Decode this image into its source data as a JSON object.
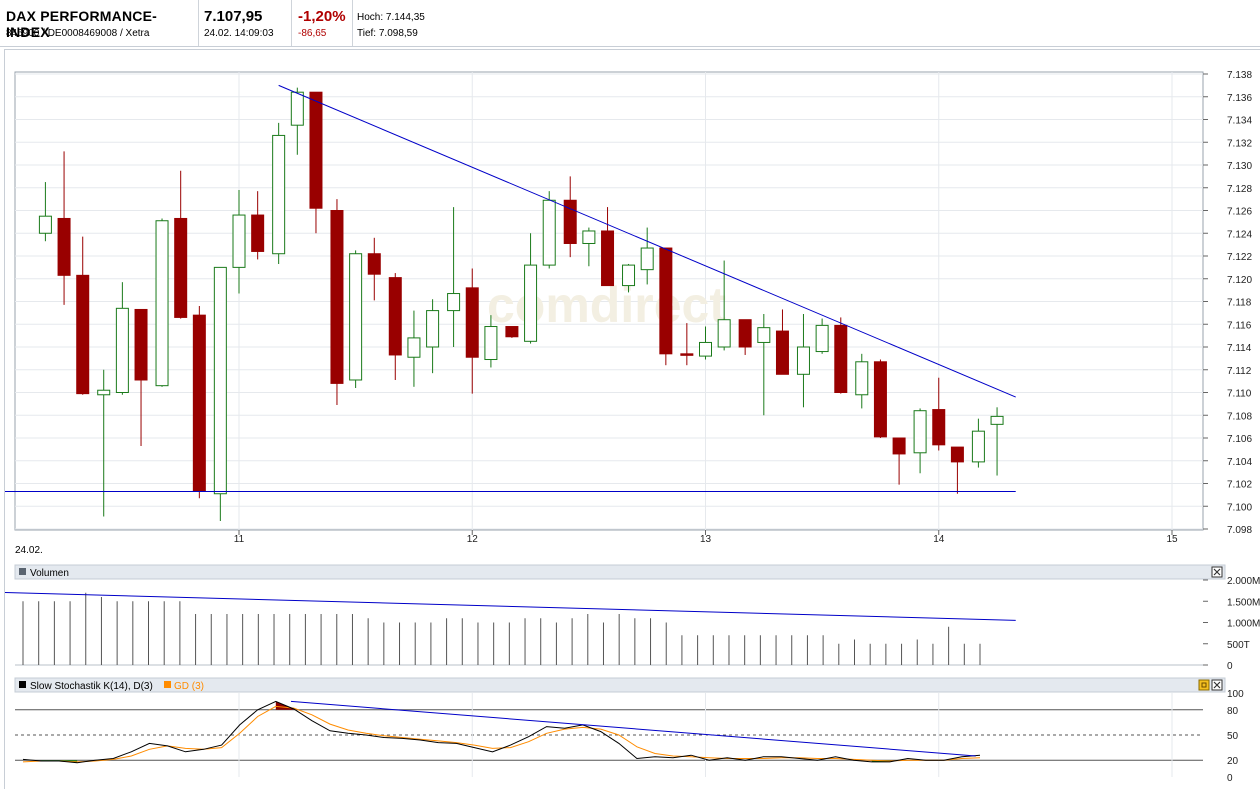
{
  "header": {
    "name": "DAX PERFORMANCE-INDEX",
    "ids": "846900 / DE0008469008 / Xetra",
    "price": "7.107,95",
    "datetime": "24.02. 14:09:03",
    "change_pct": "-1,20%",
    "change_abs": "-86,65",
    "high": "Hoch: 7.144,35",
    "low": "Tief: 7.098,59"
  },
  "watermark": "comdirect",
  "main_chart": {
    "date_label": "24.02.",
    "y_ticks": [
      "7.138",
      "7.136",
      "7.134",
      "7.132",
      "7.130",
      "7.128",
      "7.126",
      "7.124",
      "7.122",
      "7.120",
      "7.118",
      "7.116",
      "7.114",
      "7.112",
      "7.110",
      "7.108",
      "7.106",
      "7.104",
      "7.102",
      "7.100",
      "7.098"
    ],
    "x_ticks": [
      "11",
      "12",
      "13",
      "14",
      "15"
    ]
  },
  "volume_panel": {
    "title": "Volumen",
    "y_ticks": [
      "2.000M",
      "1.500M",
      "1.000M",
      "500T",
      "0"
    ]
  },
  "stoch_panel": {
    "title": "Slow Stochastik K(14), D(3)",
    "gd_label": "GD (3)",
    "y_ticks": [
      "100",
      "80",
      "50",
      "20",
      "0"
    ]
  },
  "colors": {
    "up": "#ffffff",
    "up_border": "#1a7a1a",
    "down": "#990000",
    "trendline": "#0000c8",
    "k_line": "#000000",
    "d_line": "#ff8c00",
    "overbought_fill": "#8b0000",
    "oversold_fill": "#1a8a1a"
  },
  "chart_data": {
    "type": "candlestick",
    "x_label": "24.02.",
    "x_ticks": [
      11,
      12,
      13,
      14,
      15
    ],
    "ylim": [
      7098,
      7138.5
    ],
    "candles": [
      {
        "t": 10.17,
        "o": 7124.0,
        "h": 7128.5,
        "l": 7123.3,
        "c": 7125.5
      },
      {
        "t": 10.25,
        "o": 7125.3,
        "h": 7131.2,
        "l": 7117.7,
        "c": 7120.3
      },
      {
        "t": 10.33,
        "o": 7120.3,
        "h": 7123.7,
        "l": 7109.8,
        "c": 7109.9
      },
      {
        "t": 10.42,
        "o": 7109.8,
        "h": 7112.0,
        "l": 7099.1,
        "c": 7110.2
      },
      {
        "t": 10.5,
        "o": 7110.0,
        "h": 7119.7,
        "l": 7109.8,
        "c": 7117.4
      },
      {
        "t": 10.58,
        "o": 7117.3,
        "h": 7117.3,
        "l": 7105.3,
        "c": 7111.1
      },
      {
        "t": 10.67,
        "o": 7110.6,
        "h": 7125.3,
        "l": 7110.5,
        "c": 7125.1
      },
      {
        "t": 10.75,
        "o": 7125.3,
        "h": 7129.5,
        "l": 7116.5,
        "c": 7116.6
      },
      {
        "t": 10.83,
        "o": 7116.8,
        "h": 7117.6,
        "l": 7100.7,
        "c": 7101.3
      },
      {
        "t": 10.92,
        "o": 7101.1,
        "h": 7121.0,
        "l": 7098.7,
        "c": 7121.0
      },
      {
        "t": 11.0,
        "o": 7121.0,
        "h": 7127.8,
        "l": 7118.7,
        "c": 7125.6
      },
      {
        "t": 11.08,
        "o": 7125.6,
        "h": 7127.7,
        "l": 7121.7,
        "c": 7122.4
      },
      {
        "t": 11.17,
        "o": 7122.2,
        "h": 7133.7,
        "l": 7121.3,
        "c": 7132.6
      },
      {
        "t": 11.25,
        "o": 7133.5,
        "h": 7136.8,
        "l": 7130.9,
        "c": 7136.4
      },
      {
        "t": 11.33,
        "o": 7136.4,
        "h": 7136.4,
        "l": 7124.0,
        "c": 7126.2
      },
      {
        "t": 11.42,
        "o": 7126.0,
        "h": 7127.0,
        "l": 7108.9,
        "c": 7110.8
      },
      {
        "t": 11.5,
        "o": 7111.1,
        "h": 7122.5,
        "l": 7110.4,
        "c": 7122.2
      },
      {
        "t": 11.58,
        "o": 7122.2,
        "h": 7123.6,
        "l": 7118.1,
        "c": 7120.4
      },
      {
        "t": 11.67,
        "o": 7120.1,
        "h": 7120.5,
        "l": 7111.1,
        "c": 7113.3
      },
      {
        "t": 11.75,
        "o": 7113.1,
        "h": 7117.2,
        "l": 7110.5,
        "c": 7114.8
      },
      {
        "t": 11.83,
        "o": 7114.0,
        "h": 7118.2,
        "l": 7111.7,
        "c": 7117.2
      },
      {
        "t": 11.92,
        "o": 7117.2,
        "h": 7126.3,
        "l": 7114.0,
        "c": 7118.7
      },
      {
        "t": 12.0,
        "o": 7119.2,
        "h": 7120.9,
        "l": 7109.9,
        "c": 7113.1
      },
      {
        "t": 12.08,
        "o": 7112.9,
        "h": 7116.8,
        "l": 7112.2,
        "c": 7115.8
      },
      {
        "t": 12.17,
        "o": 7115.8,
        "h": 7115.8,
        "l": 7114.8,
        "c": 7114.9
      },
      {
        "t": 12.25,
        "o": 7114.5,
        "h": 7124.0,
        "l": 7114.3,
        "c": 7121.2
      },
      {
        "t": 12.33,
        "o": 7121.2,
        "h": 7127.7,
        "l": 7120.9,
        "c": 7126.9
      },
      {
        "t": 12.42,
        "o": 7126.9,
        "h": 7129.0,
        "l": 7121.9,
        "c": 7123.1
      },
      {
        "t": 12.5,
        "o": 7123.1,
        "h": 7124.5,
        "l": 7121.1,
        "c": 7124.2
      },
      {
        "t": 12.58,
        "o": 7124.2,
        "h": 7126.3,
        "l": 7119.5,
        "c": 7119.4
      },
      {
        "t": 12.67,
        "o": 7119.4,
        "h": 7121.3,
        "l": 7118.8,
        "c": 7121.2
      },
      {
        "t": 12.75,
        "o": 7120.8,
        "h": 7124.5,
        "l": 7119.5,
        "c": 7122.7
      },
      {
        "t": 12.83,
        "o": 7122.7,
        "h": 7122.7,
        "l": 7112.4,
        "c": 7113.4
      },
      {
        "t": 12.92,
        "o": 7113.4,
        "h": 7116.1,
        "l": 7112.4,
        "c": 7113.3
      },
      {
        "t": 13.0,
        "o": 7113.2,
        "h": 7115.8,
        "l": 7112.9,
        "c": 7114.4
      },
      {
        "t": 13.08,
        "o": 7114.0,
        "h": 7121.6,
        "l": 7113.7,
        "c": 7116.4
      },
      {
        "t": 13.17,
        "o": 7116.4,
        "h": 7116.4,
        "l": 7113.3,
        "c": 7114.0
      },
      {
        "t": 13.25,
        "o": 7114.4,
        "h": 7116.9,
        "l": 7108.0,
        "c": 7115.7
      },
      {
        "t": 13.33,
        "o": 7115.4,
        "h": 7117.3,
        "l": 7111.6,
        "c": 7111.6
      },
      {
        "t": 13.42,
        "o": 7111.6,
        "h": 7116.9,
        "l": 7108.7,
        "c": 7114.0
      },
      {
        "t": 13.5,
        "o": 7113.6,
        "h": 7116.5,
        "l": 7113.4,
        "c": 7115.9
      },
      {
        "t": 13.58,
        "o": 7115.9,
        "h": 7116.6,
        "l": 7109.9,
        "c": 7110.0
      },
      {
        "t": 13.67,
        "o": 7109.8,
        "h": 7113.4,
        "l": 7108.6,
        "c": 7112.7
      },
      {
        "t": 13.75,
        "o": 7112.7,
        "h": 7112.9,
        "l": 7106.0,
        "c": 7106.1
      },
      {
        "t": 13.83,
        "o": 7106.0,
        "h": 7106.0,
        "l": 7101.9,
        "c": 7104.6
      },
      {
        "t": 13.92,
        "o": 7104.7,
        "h": 7108.6,
        "l": 7102.9,
        "c": 7108.4
      },
      {
        "t": 14.0,
        "o": 7108.5,
        "h": 7111.3,
        "l": 7104.9,
        "c": 7105.4
      },
      {
        "t": 14.08,
        "o": 7105.2,
        "h": 7105.2,
        "l": 7101.1,
        "c": 7103.9
      },
      {
        "t": 14.17,
        "o": 7103.9,
        "h": 7107.7,
        "l": 7103.4,
        "c": 7106.6
      },
      {
        "t": 14.25,
        "o": 7107.2,
        "h": 7108.7,
        "l": 7102.7,
        "c": 7107.9
      }
    ],
    "trendline_resistance": [
      {
        "t": 11.17,
        "v": 7137.0
      },
      {
        "t": 14.33,
        "v": 7109.6
      }
    ],
    "trendline_support": [
      {
        "t": 10.17,
        "v": 7101.3
      },
      {
        "t": 14.33,
        "v": 7101.3
      }
    ],
    "volume": {
      "ylim": [
        0,
        2000000
      ],
      "values": [
        1500000,
        1500000,
        1500000,
        1500000,
        1700000,
        1600000,
        1500000,
        1500000,
        1500000,
        1500000,
        1500000,
        1200000,
        1200000,
        1200000,
        1200000,
        1200000,
        1200000,
        1200000,
        1200000,
        1200000,
        1200000,
        1200000,
        1100000,
        1000000,
        1000000,
        1000000,
        1000000,
        1100000,
        1100000,
        1000000,
        1000000,
        1000000,
        1100000,
        1100000,
        1000000,
        1100000,
        1200000,
        1000000,
        1200000,
        1100000,
        1100000,
        1000000,
        700000,
        700000,
        700000,
        700000,
        700000,
        700000,
        700000,
        700000,
        700000,
        700000,
        500000,
        600000,
        500000,
        500000,
        500000,
        600000,
        500000,
        900000,
        500000,
        500000
      ],
      "trendline": [
        {
          "t": 10.42,
          "v": 1750000
        },
        {
          "t": 14.33,
          "v": 1050000
        }
      ]
    },
    "stochastic": {
      "ylim": [
        0,
        100
      ],
      "levels": [
        80,
        50,
        20
      ],
      "k": [
        21,
        19,
        19,
        17,
        20,
        22,
        30,
        40,
        37,
        30,
        33,
        38,
        62,
        80,
        90,
        81,
        67,
        55,
        52,
        50,
        47,
        46,
        44,
        41,
        40,
        35,
        30,
        38,
        48,
        60,
        58,
        62,
        54,
        40,
        22,
        24,
        23,
        26,
        20,
        23,
        20,
        24,
        24,
        22,
        20,
        24,
        20,
        18,
        18,
        22,
        20,
        20,
        24,
        26
      ],
      "d": [
        18,
        19,
        19,
        18,
        19,
        21,
        25,
        33,
        37,
        34,
        33,
        35,
        52,
        72,
        84,
        82,
        74,
        63,
        56,
        52,
        49,
        47,
        45,
        43,
        41,
        38,
        34,
        35,
        42,
        52,
        57,
        59,
        57,
        50,
        36,
        28,
        25,
        24,
        23,
        22,
        22,
        22,
        23,
        23,
        22,
        22,
        21,
        20,
        19,
        20,
        20,
        20,
        22,
        23
      ],
      "trendline": [
        {
          "t": 11.33,
          "v": 90
        },
        {
          "t": 14.33,
          "v": 25
        }
      ]
    }
  }
}
